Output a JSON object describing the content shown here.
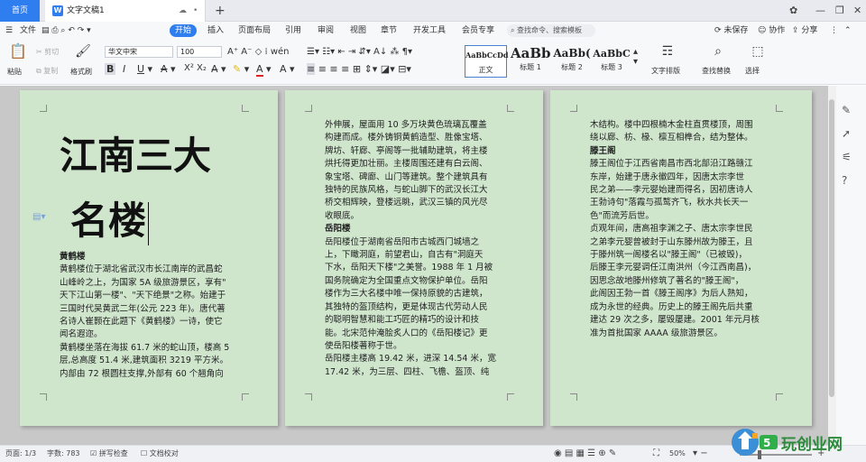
{
  "titlebar": {
    "home_tab": "首页",
    "doc_tab_icon": "W",
    "doc_tab": "文字文稿1",
    "new_tab": "+",
    "min": "—",
    "restore": "❐",
    "close": "✕"
  },
  "menu": {
    "file": "文件",
    "items": [
      "开始",
      "插入",
      "页面布局",
      "引用",
      "审阅",
      "视图",
      "章节",
      "开发工具",
      "会员专享"
    ],
    "search_placeholder": "查找命令、搜索模板",
    "unsaved": "未保存",
    "collab": "协作",
    "share": "分享"
  },
  "toolbar": {
    "paste": "粘贴",
    "cut": "剪切",
    "copy": "复制",
    "format_painter": "格式刷",
    "font_name": "华文中宋",
    "font_size": "100",
    "styles": [
      {
        "preview": "AaBbCcDd",
        "label": "正文"
      },
      {
        "preview": "AaBb",
        "label": "标题 1"
      },
      {
        "preview": "AaBb(",
        "label": "标题 2"
      },
      {
        "preview": "AaBbC",
        "label": "标题 3"
      }
    ],
    "text_layout": "文字排版",
    "find_replace": "查找替换",
    "select": "选择"
  },
  "document": {
    "title_line1": "江南三大",
    "title_line2": "名楼",
    "page1": [
      {
        "type": "heading",
        "text": "黄鹤楼"
      },
      {
        "type": "text",
        "text": "黄鹤楼位于湖北省武汉市长江南岸的武昌蛇"
      },
      {
        "type": "text",
        "text": "山峰岭之上，为国家 5A 级旅游景区，享有\""
      },
      {
        "type": "text",
        "text": "天下江山第一楼\"、\"天下绝景\"之称。始建于"
      },
      {
        "type": "text",
        "text": "三国时代吴黄武二年(公元 223 年)。唐代著"
      },
      {
        "type": "text",
        "text": "名诗人崔颢在此题下《黄鹤楼》一诗，使它"
      },
      {
        "type": "text",
        "text": "闻名遐迩。"
      },
      {
        "type": "text",
        "text": "黄鹤楼坐落在海拔 61.7 米的蛇山顶，楼高 5"
      },
      {
        "type": "text",
        "text": "层,总高度 51.4 米,建筑面积 3219 平方米。"
      },
      {
        "type": "text",
        "text": "内部由 72 根圆柱支撑,外部有 60 个翘角向"
      }
    ],
    "page2": [
      {
        "type": "text",
        "text": "外伸展，屋面用 10 多万块黄色琉璃瓦覆盖"
      },
      {
        "type": "text",
        "text": "构建而成。楼外铸铜黄鹤造型、胜像宝塔、"
      },
      {
        "type": "text",
        "text": "牌坊、轩廊、亭阁等一批辅助建筑，将主楼"
      },
      {
        "type": "text",
        "text": "烘托得更加壮丽。主楼周围还建有白云阁、"
      },
      {
        "type": "text",
        "text": "象宝塔、碑廊、山门等建筑。整个建筑具有"
      },
      {
        "type": "text",
        "text": "独特的民族风格，与蛇山脚下的武汉长江大"
      },
      {
        "type": "text",
        "text": "桥交相辉映，登楼远眺，武汉三镇的风光尽"
      },
      {
        "type": "text",
        "text": "收眼底。"
      },
      {
        "type": "heading",
        "text": "岳阳楼"
      },
      {
        "type": "text",
        "text": "岳阳楼位于湖南省岳阳市古城西门城墙之"
      },
      {
        "type": "text",
        "text": "上，下瞰洞庭，前望君山，自古有\"洞庭天"
      },
      {
        "type": "text",
        "text": "下水，岳阳天下楼\"之美誉。1988 年 1 月被"
      },
      {
        "type": "text",
        "text": "国务院确定为全国重点文物保护单位。岳阳"
      },
      {
        "type": "text",
        "text": "楼作为三大名楼中唯一保持原貌的古建筑，"
      },
      {
        "type": "text",
        "text": "其独特的盔顶结构，更是体现古代劳动人民"
      },
      {
        "type": "text",
        "text": "的聪明智慧和能工巧匠的精巧的设计和技"
      },
      {
        "type": "text",
        "text": "能。北宋范仲淹脍炙人口的《岳阳楼记》更"
      },
      {
        "type": "text",
        "text": "使岳阳楼著称于世。"
      },
      {
        "type": "text",
        "text": "岳阳楼主楼高 19.42 米，进深 14.54 米，宽"
      },
      {
        "type": "text",
        "text": "17.42 米，为三层、四柱、飞檐、盔顶、纯"
      }
    ],
    "page3": [
      {
        "type": "text",
        "text": "木结构。楼中四根楠木金柱直贯楼顶，周围"
      },
      {
        "type": "text",
        "text": "绕以廊、枋、椽、檩互相榫合，结为整体。"
      },
      {
        "type": "heading",
        "text": "滕王阁"
      },
      {
        "type": "text",
        "text": "滕王阁位于江西省南昌市西北部沿江路赣江"
      },
      {
        "type": "text",
        "text": "东岸，始建于唐永徽四年，因唐太宗李世"
      },
      {
        "type": "text",
        "text": "民之弟——李元婴始建而得名，因初唐诗人"
      },
      {
        "type": "text",
        "text": "王勃诗句\"落霞与孤鹜齐飞，秋水共长天一"
      },
      {
        "type": "text",
        "text": "色\"而流芳后世。"
      },
      {
        "type": "text",
        "text": "贞观年间，唐高祖李渊之子、唐太宗李世民"
      },
      {
        "type": "text",
        "text": "之弟李元婴曾被封于山东滕州故为滕王，且"
      },
      {
        "type": "text",
        "text": "于滕州筑一阁楼名以\"滕王阁\"（已被毁)，"
      },
      {
        "type": "text",
        "text": "后滕王李元婴调任江南洪州（今江西南昌)，"
      },
      {
        "type": "text",
        "text": "因思念故地滕州修筑了著名的\"滕王阁\"，"
      },
      {
        "type": "text",
        "text": "此阁因王勃一首《滕王阁序》为后人熟知，"
      },
      {
        "type": "text",
        "text": "成为永世的经典。历史上的滕王阁先后共重"
      },
      {
        "type": "text",
        "text": "建达 29 次之多，屡毁屡建。2001 年元月核"
      },
      {
        "type": "text",
        "text": "准为首批国家 AAAA 级旅游景区。"
      }
    ]
  },
  "status": {
    "page": "页面: 1/3",
    "words": "字数: 783",
    "spellcheck": "拼写检查",
    "doc_check": "文档校对",
    "zoom": "50%",
    "watermark": "玩创业网"
  },
  "colors": {
    "accent": "#2f7ef0",
    "page_bg": "#cfe6cd",
    "workspace_bg": "#c8c8c8"
  }
}
